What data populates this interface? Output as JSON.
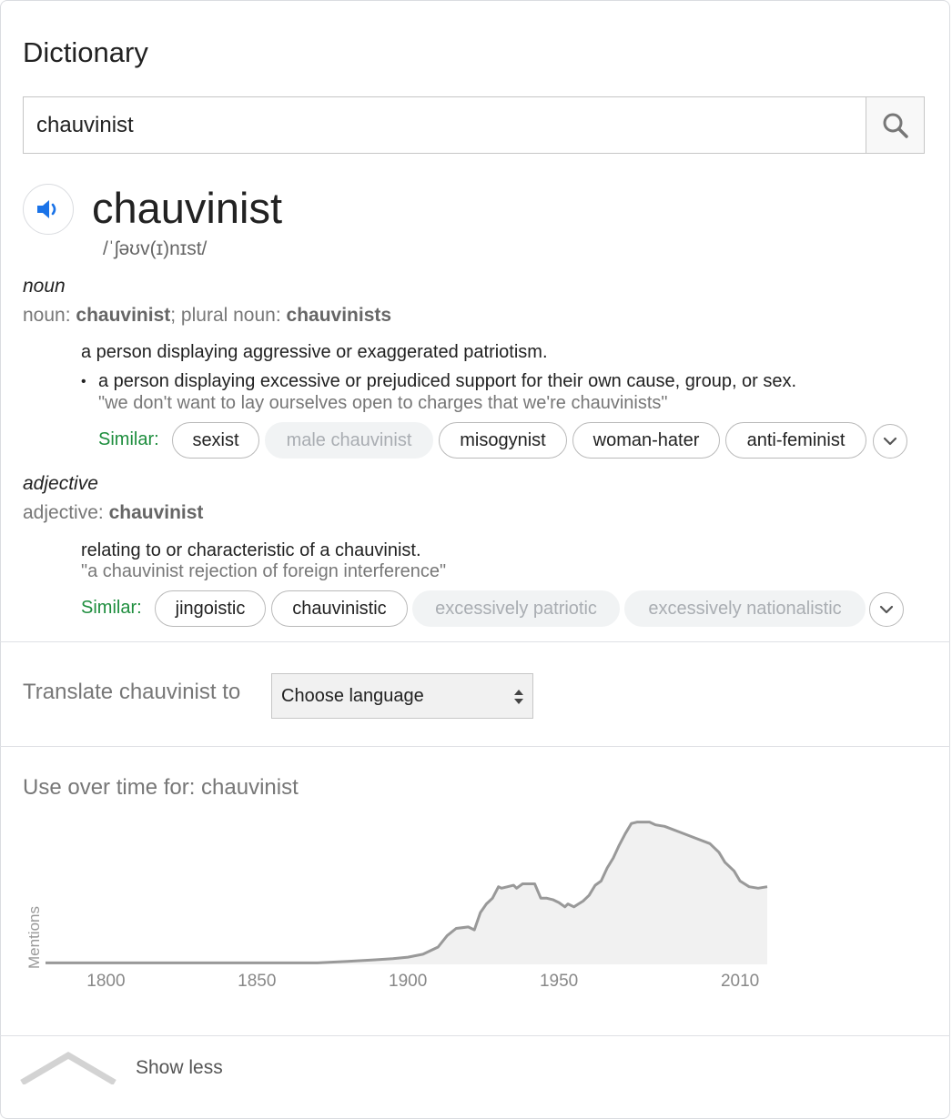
{
  "header": {
    "title": "Dictionary"
  },
  "search": {
    "value": "chauvinist",
    "button": "search-icon"
  },
  "entry": {
    "word": "chauvinist",
    "phonetic": "/ˈʃəʊv(ɪ)nɪst/",
    "speaker_icon": "speaker-icon"
  },
  "noun": {
    "pos": "noun",
    "forms_prefix": "noun: ",
    "forms_word": "chauvinist",
    "forms_mid": "; plural noun: ",
    "forms_plural": "chauvinists",
    "def1": "a person displaying aggressive or exaggerated patriotism.",
    "def2": "a person displaying excessive or prejudiced support for their own cause, group, or sex.",
    "example2": "\"we don't want to lay ourselves open to charges that we're chauvinists\"",
    "similar_label": "Similar:",
    "similar": [
      "sexist",
      "male chauvinist",
      "misogynist",
      "woman-hater",
      "anti-feminist"
    ]
  },
  "adjective": {
    "pos": "adjective",
    "forms_prefix": "adjective: ",
    "forms_word": "chauvinist",
    "def1": "relating to or characteristic of a chauvinist.",
    "example1": "\"a chauvinist rejection of foreign interference\"",
    "similar_label": "Similar:",
    "similar": [
      "jingoistic",
      "chauvinistic",
      "excessively patriotic",
      "excessively nationalistic"
    ]
  },
  "translate": {
    "label": "Translate chauvinist to",
    "select_value": "Choose language"
  },
  "usage": {
    "title": "Use over time for: chauvinist"
  },
  "chart_data": {
    "type": "area",
    "ylabel": "Mentions",
    "xlabel": "",
    "xlim": [
      1780,
      2019
    ],
    "x_ticks": [
      "1800",
      "1850",
      "1900",
      "1950",
      "2010"
    ],
    "ylim": [
      0,
      100
    ],
    "grid": false,
    "x": [
      1780,
      1800,
      1850,
      1870,
      1880,
      1888,
      1895,
      1900,
      1905,
      1910,
      1913,
      1916,
      1920,
      1922,
      1924,
      1926,
      1928,
      1930,
      1931,
      1933,
      1935,
      1936,
      1938,
      1940,
      1942,
      1944,
      1946,
      1948,
      1950,
      1952,
      1953,
      1955,
      1958,
      1960,
      1962,
      1964,
      1966,
      1968,
      1970,
      1972,
      1974,
      1976,
      1978,
      1980,
      1982,
      1985,
      1990,
      1995,
      2000,
      2003,
      2005,
      2008,
      2010,
      2013,
      2016,
      2019
    ],
    "values": [
      1,
      1,
      1,
      1,
      2,
      3,
      4,
      5,
      7,
      12,
      20,
      25,
      26,
      24,
      36,
      42,
      46,
      54,
      53,
      54,
      55,
      53,
      56,
      56,
      56,
      46,
      46,
      45,
      43,
      40,
      42,
      40,
      44,
      48,
      55,
      58,
      67,
      74,
      83,
      91,
      98,
      99,
      99,
      99,
      97,
      96,
      92,
      88,
      84,
      78,
      71,
      65,
      58,
      54,
      53,
      54
    ]
  },
  "footer": {
    "show_less": "Show less"
  }
}
